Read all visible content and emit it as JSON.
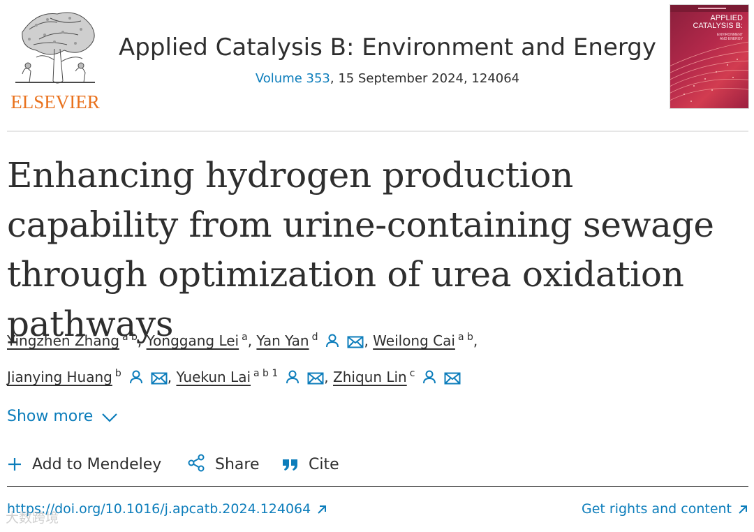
{
  "publisher": {
    "name": "ELSEVIER"
  },
  "journal": {
    "title": "Applied Catalysis B: Environment and Energy",
    "volume_link": "Volume 353",
    "issue_info": ", 15 September 2024, 124064",
    "cover_title_line1": "APPLIED",
    "cover_title_line2": "CATALYSIS B:",
    "cover_sub_line1": "ENVIRONMENT",
    "cover_sub_line2": "AND ENERGY"
  },
  "article": {
    "title": "Enhancing hydrogen production capability from urine-containing sewage through optimization of urea oxidation pathways"
  },
  "authors": [
    {
      "name": "Yingzhen Zhang",
      "aff": "a b",
      "person_icon": false,
      "mail_icon": false
    },
    {
      "name": "Yonggang Lei",
      "aff": "a",
      "person_icon": false,
      "mail_icon": false
    },
    {
      "name": "Yan Yan",
      "aff": "d",
      "person_icon": true,
      "mail_icon": true
    },
    {
      "name": "Weilong Cai",
      "aff": "a b",
      "person_icon": false,
      "mail_icon": false
    },
    {
      "name": "Jianying Huang",
      "aff": "b",
      "person_icon": true,
      "mail_icon": true
    },
    {
      "name": "Yuekun Lai",
      "aff": "a b 1",
      "person_icon": true,
      "mail_icon": true
    },
    {
      "name": "Zhiqun Lin",
      "aff": "c",
      "person_icon": true,
      "mail_icon": true
    }
  ],
  "show_more": {
    "label": "Show more",
    "icon": "chevron-down-icon"
  },
  "actions": {
    "mendeley": {
      "label": "Add to Mendeley",
      "icon": "plus-icon"
    },
    "share": {
      "label": "Share",
      "icon": "share-icon"
    },
    "cite": {
      "label": "Cite",
      "icon": "quote-icon"
    }
  },
  "links": {
    "doi": "https://doi.org/10.1016/j.apcatb.2024.124064",
    "rights": "Get rights and content"
  },
  "watermark": "大数跨境",
  "colors": {
    "link": "#0c7dbb",
    "elsevier_orange": "#e9711c",
    "cover": "#b5294b",
    "text": "#2e2e2e"
  }
}
